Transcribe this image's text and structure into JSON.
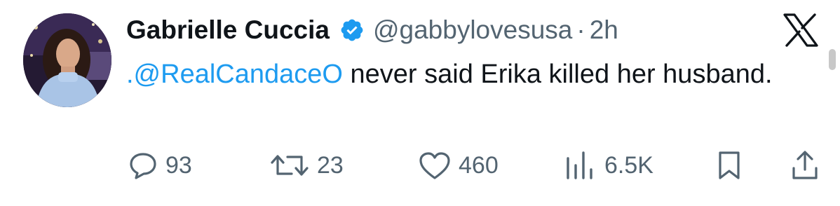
{
  "tweet": {
    "author_name": "Gabrielle Cuccia",
    "handle": "@gabbylovesusa",
    "separator": "·",
    "time": "2h",
    "mention": ".@RealCandaceO",
    "text_rest": " never said Erika killed her husband."
  },
  "actions": {
    "replies": "93",
    "reposts": "23",
    "likes": "460",
    "views": "6.5K"
  },
  "icons": {
    "verified": "verified-badge-icon",
    "platform": "x-logo-icon",
    "reply": "reply-icon",
    "repost": "repost-icon",
    "like": "heart-icon",
    "views": "views-icon",
    "bookmark": "bookmark-icon",
    "share": "share-icon"
  },
  "colors": {
    "accent": "#1d9bf0",
    "text": "#0f1419",
    "muted": "#536471"
  }
}
